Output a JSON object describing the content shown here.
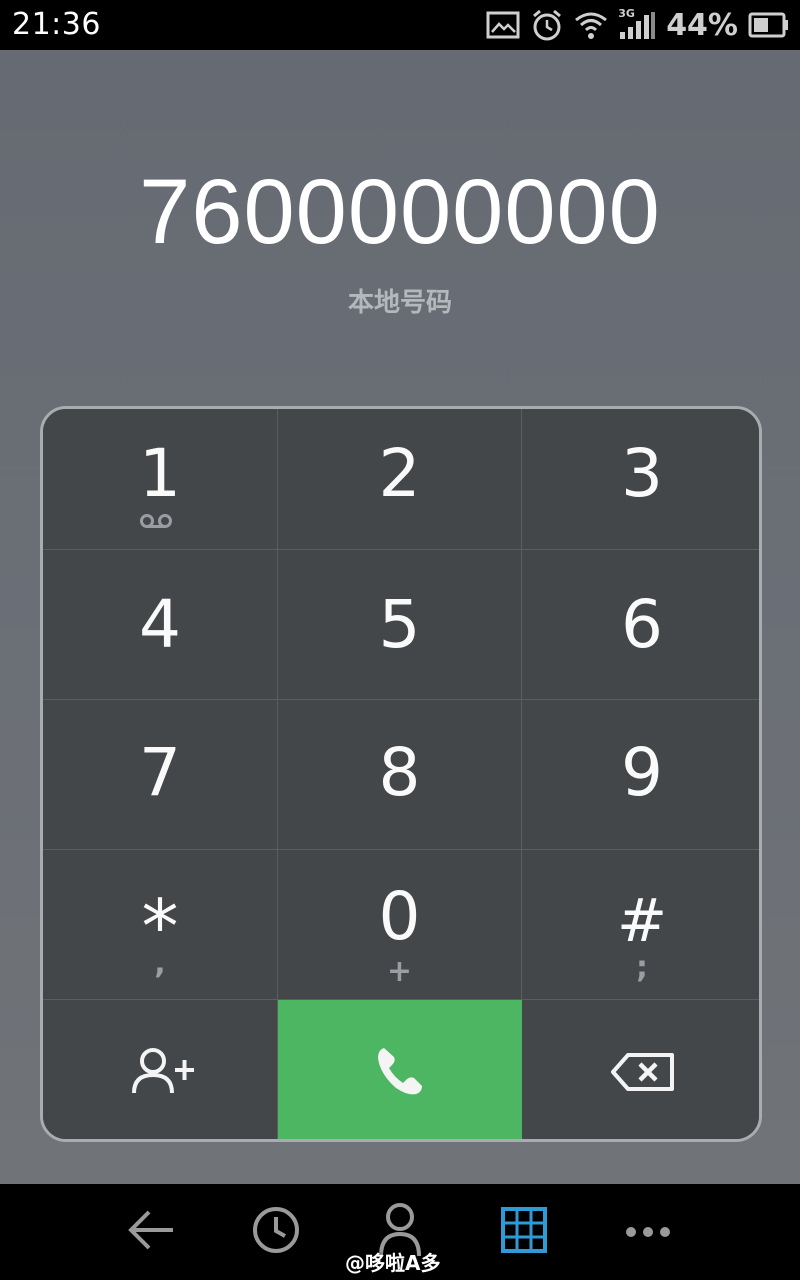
{
  "status_bar": {
    "time": "21:36",
    "battery_percent": "44%",
    "network": "3G",
    "icons": [
      "image-notification-icon",
      "alarm-icon",
      "wifi-icon",
      "signal-icon",
      "battery-icon"
    ]
  },
  "dialer": {
    "number": "7600000000",
    "location": "本地号码"
  },
  "keypad": {
    "keys": [
      {
        "digit": "1",
        "sub": ""
      },
      {
        "digit": "2",
        "sub": ""
      },
      {
        "digit": "3",
        "sub": ""
      },
      {
        "digit": "4",
        "sub": ""
      },
      {
        "digit": "5",
        "sub": ""
      },
      {
        "digit": "6",
        "sub": ""
      },
      {
        "digit": "7",
        "sub": ""
      },
      {
        "digit": "8",
        "sub": ""
      },
      {
        "digit": "9",
        "sub": ""
      },
      {
        "digit": "*",
        "sub": ","
      },
      {
        "digit": "0",
        "sub": "+"
      },
      {
        "digit": "#",
        "sub": ";"
      }
    ],
    "actions": [
      "add-contact-icon",
      "call-icon",
      "backspace-icon"
    ],
    "call_color": "#4cb663"
  },
  "navbar": {
    "items": [
      "back-icon",
      "recent-calls-icon",
      "contacts-icon",
      "dialpad-icon",
      "more-icon"
    ],
    "active_color": "#2e9bd6"
  },
  "watermark": "@哆啦A多"
}
